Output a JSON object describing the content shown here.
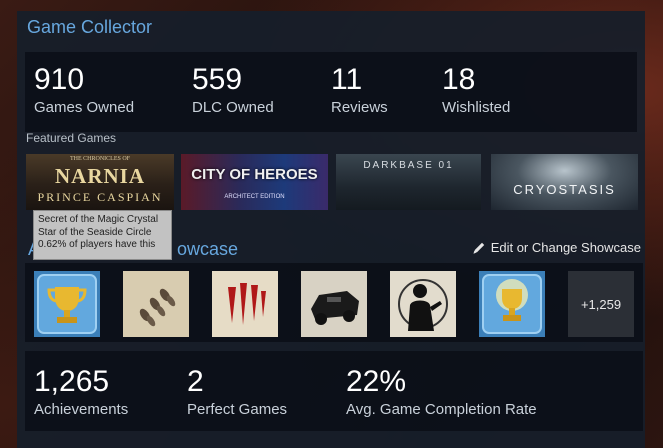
{
  "showcase": {
    "title": "Game Collector",
    "stats": [
      {
        "value": "910",
        "label": "Games Owned"
      },
      {
        "value": "559",
        "label": "DLC Owned"
      },
      {
        "value": "11",
        "label": "Reviews"
      },
      {
        "value": "18",
        "label": "Wishlisted"
      }
    ],
    "featured_label": "Featured Games",
    "featured_games": [
      {
        "caption_top": "NARNIA",
        "caption_bottom": "PRINCE CASPIAN",
        "small": "THE CHRONICLES OF"
      },
      {
        "caption_top": "CITY OF HEROES",
        "caption_bottom": "ARCHITECT EDITION"
      },
      {
        "caption_top": "DARKBASE 01",
        "caption_bottom": ""
      },
      {
        "caption_top": "CRYOSTASIS",
        "caption_bottom": ""
      }
    ]
  },
  "tooltip": {
    "line1": "Secret of the Magic Crystal",
    "line2": "Star of the Seaside Circle",
    "line3": "0.62% of players have this"
  },
  "achievements": {
    "title_prefix": "A",
    "title_suffix": "owcase",
    "edit_label": "Edit or Change Showcase",
    "more_count": "+1,259",
    "icons": [
      "gold-trophy-icon",
      "footprints-icon",
      "claw-marks-icon",
      "armored-car-icon",
      "silhouette-man-icon",
      "shining-trophy-icon"
    ],
    "stats": [
      {
        "value": "1,265",
        "label": "Achievements"
      },
      {
        "value": "2",
        "label": "Perfect Games"
      },
      {
        "value": "22%",
        "label": "Avg. Game Completion Rate"
      }
    ]
  },
  "colors": {
    "accent": "#67a7de",
    "panel": "#161e2a"
  }
}
